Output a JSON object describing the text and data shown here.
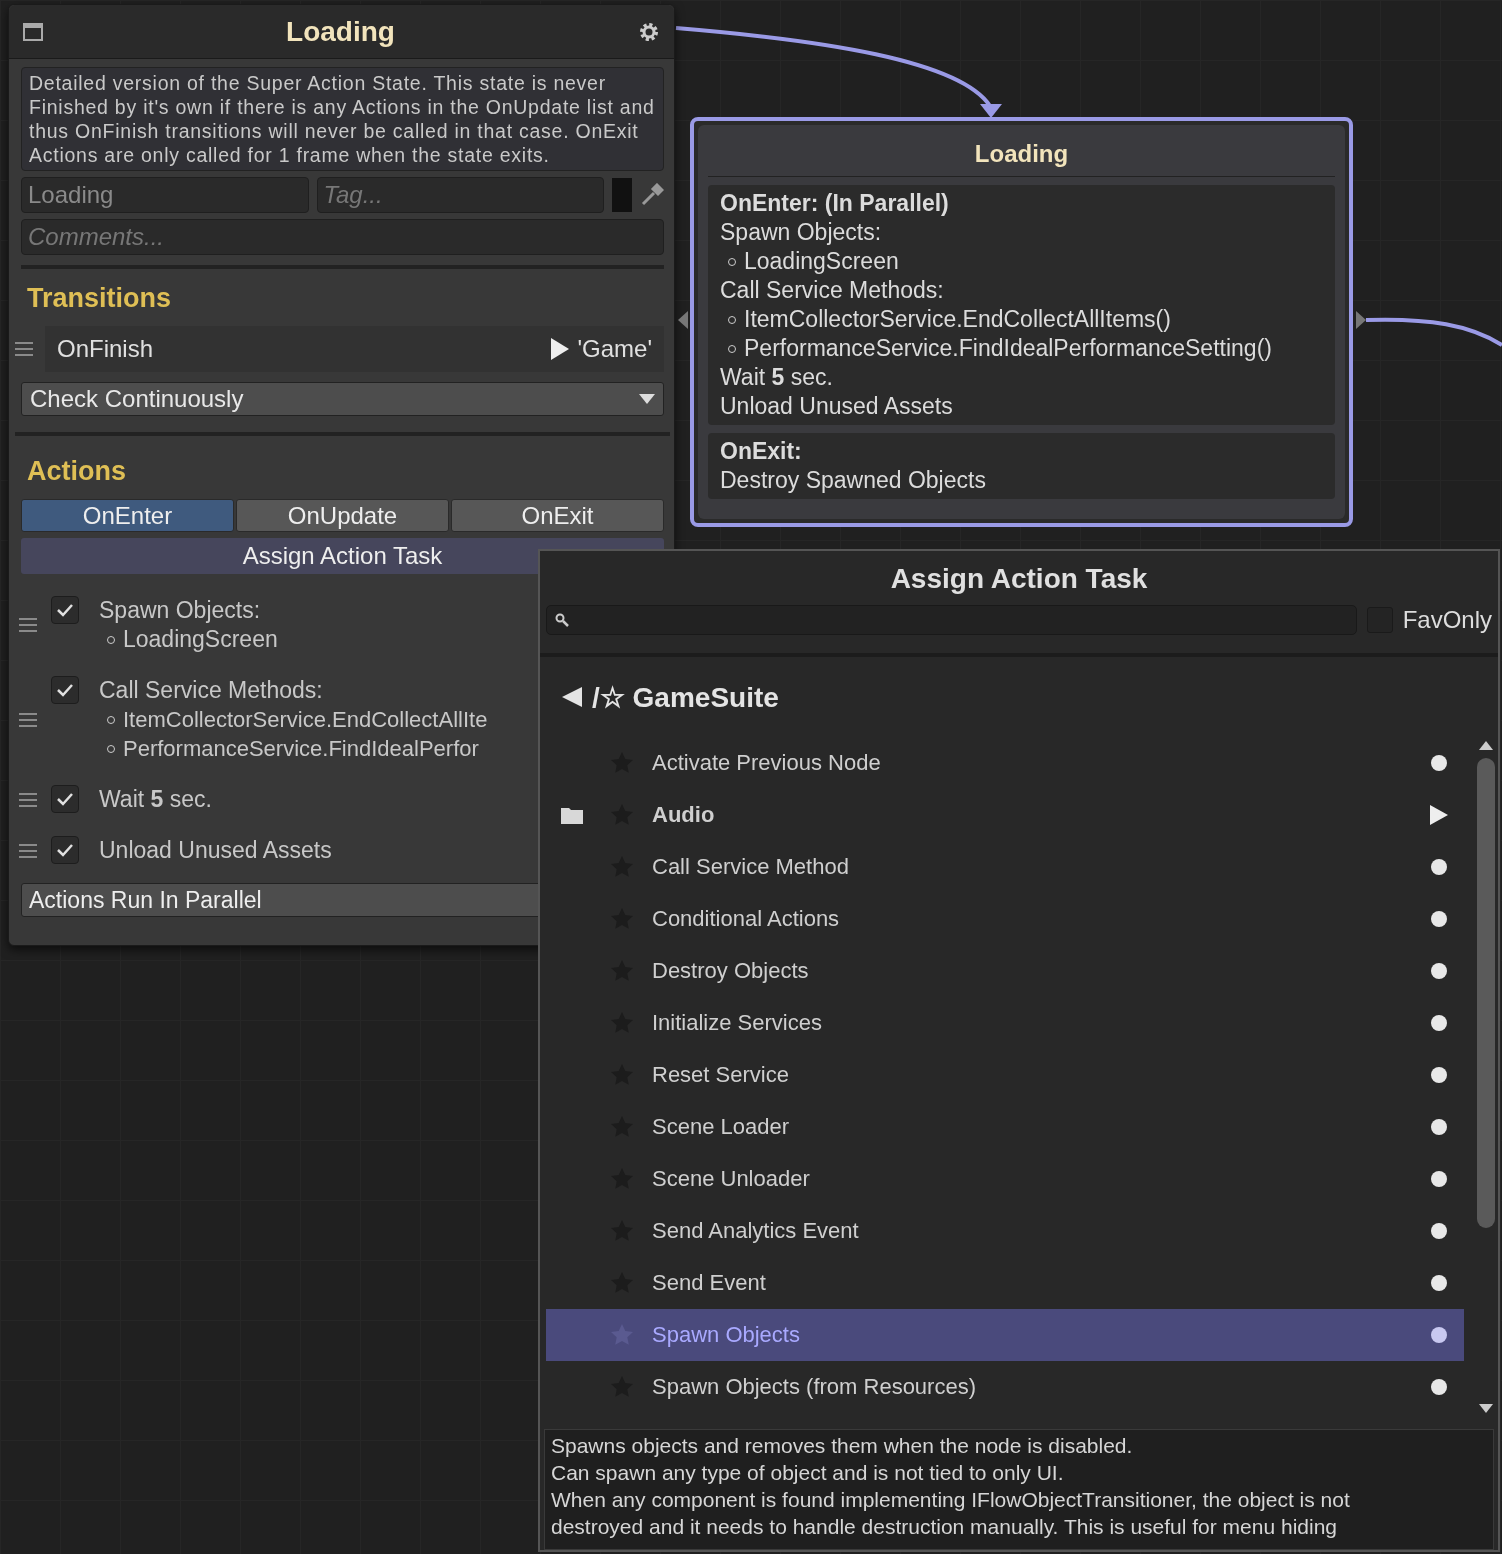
{
  "inspector": {
    "title": "Loading",
    "description": "Detailed version of the Super Action State. This state is never Finished by it's own if there is any Actions in the OnUpdate list and thus OnFinish transitions will never be called in that case. OnExit Actions are only called for 1 frame when the state exits.",
    "name_value": "Loading",
    "tag_placeholder": "Tag...",
    "comments_placeholder": "Comments...",
    "transitions_heading": "Transitions",
    "transitions": [
      {
        "event": "OnFinish",
        "target": "'Game'"
      }
    ],
    "check_mode": "Check Continuously",
    "actions_heading": "Actions",
    "tabs": [
      {
        "label": "OnEnter",
        "selected": true
      },
      {
        "label": "OnUpdate",
        "selected": false
      },
      {
        "label": "OnExit",
        "selected": false
      }
    ],
    "assign_button": "Assign Action Task",
    "actions": [
      {
        "title": "Spawn Objects:",
        "items": [
          "LoadingScreen"
        ],
        "checked": true
      },
      {
        "title": "Call Service Methods:",
        "items": [
          "ItemCollectorService.EndCollectAllIte",
          "PerformanceService.FindIdealPerfor"
        ],
        "checked": true
      },
      {
        "title": "Wait **5** sec.",
        "checked": true
      },
      {
        "title": "Unload Unused Assets",
        "checked": true
      }
    ],
    "run_mode": "Actions Run In Parallel"
  },
  "node": {
    "title": "Loading",
    "sections": [
      {
        "heading": "OnEnter: (In Parallel)",
        "lines": [
          {
            "kind": "line",
            "text": "Spawn Objects:"
          },
          {
            "kind": "bullet",
            "text": "LoadingScreen"
          },
          {
            "kind": "line",
            "text": "Call Service Methods:"
          },
          {
            "kind": "bullet",
            "text": "ItemCollectorService.EndCollectAllItems()"
          },
          {
            "kind": "bullet",
            "text": "PerformanceService.FindIdealPerformanceSetting()"
          },
          {
            "kind": "line",
            "text": "Wait **5** sec."
          },
          {
            "kind": "line",
            "text": "Unload Unused Assets"
          }
        ]
      },
      {
        "heading": "OnExit:",
        "lines": [
          {
            "kind": "line",
            "text": "Destroy Spawned Objects"
          }
        ]
      }
    ]
  },
  "popup": {
    "title": "Assign Action Task",
    "fav_only": {
      "label": "FavOnly",
      "checked": false
    },
    "breadcrumb": "/☆ GameSuite",
    "items": [
      {
        "label": "Activate Previous Node",
        "kind": "action",
        "selected": false
      },
      {
        "label": "Audio",
        "kind": "folder",
        "selected": false
      },
      {
        "label": "Call Service Method",
        "kind": "action",
        "selected": false
      },
      {
        "label": "Conditional Actions",
        "kind": "action",
        "selected": false
      },
      {
        "label": "Destroy Objects",
        "kind": "action",
        "selected": false
      },
      {
        "label": "Initialize Services",
        "kind": "action",
        "selected": false
      },
      {
        "label": "Reset Service",
        "kind": "action",
        "selected": false
      },
      {
        "label": "Scene Loader",
        "kind": "action",
        "selected": false
      },
      {
        "label": "Scene Unloader",
        "kind": "action",
        "selected": false
      },
      {
        "label": "Send Analytics Event",
        "kind": "action",
        "selected": false
      },
      {
        "label": "Send Event",
        "kind": "action",
        "selected": false
      },
      {
        "label": "Spawn Objects",
        "kind": "action",
        "selected": true
      },
      {
        "label": "Spawn Objects (from Resources)",
        "kind": "action",
        "selected": false
      }
    ],
    "description_lines": [
      "Spawns objects and removes them when the node is disabled.",
      "Can spawn any type of object and is not tied to only UI.",
      "When any component is found implementing IFlowObjectTransitioner, the object is not",
      "destroyed and it needs to handle destruction manually. This is useful for menu hiding"
    ]
  }
}
